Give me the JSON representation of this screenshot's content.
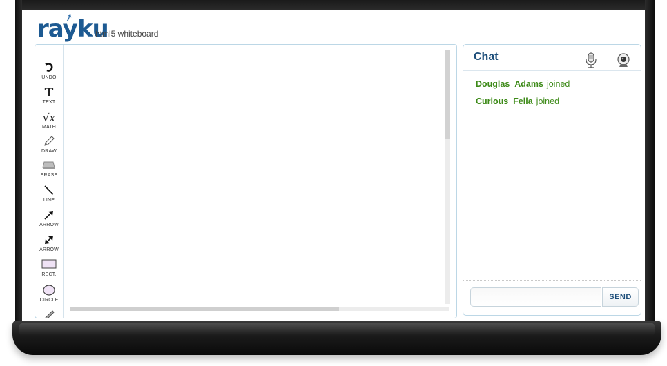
{
  "header": {
    "logo_text": "rayku",
    "subtitle": "html5 whiteboard"
  },
  "toolbar": {
    "tools": [
      {
        "label": "UNDO",
        "icon": "undo-icon"
      },
      {
        "label": "TEXT",
        "icon": "text-icon"
      },
      {
        "label": "MATH",
        "icon": "math-icon"
      },
      {
        "label": "DRAW",
        "icon": "pencil-icon"
      },
      {
        "label": "ERASE",
        "icon": "eraser-icon"
      },
      {
        "label": "LINE",
        "icon": "line-icon"
      },
      {
        "label": "ARROW",
        "icon": "arrow-icon"
      },
      {
        "label": "ARROW",
        "icon": "double-arrow-icon"
      },
      {
        "label": "RECT.",
        "icon": "rectangle-icon"
      },
      {
        "label": "CIRCLE",
        "icon": "circle-icon"
      },
      {
        "label": "",
        "icon": "brush-icon"
      }
    ]
  },
  "chat": {
    "title": "Chat",
    "messages": [
      {
        "user": "Douglas_Adams",
        "action": "joined"
      },
      {
        "user": "Curious_Fella",
        "action": "joined"
      }
    ],
    "input_value": "",
    "send_label": "SEND"
  },
  "colors": {
    "brand": "#1d5a92",
    "chat_user": "#3d8a18",
    "panel_border": "#bcd7e6"
  }
}
